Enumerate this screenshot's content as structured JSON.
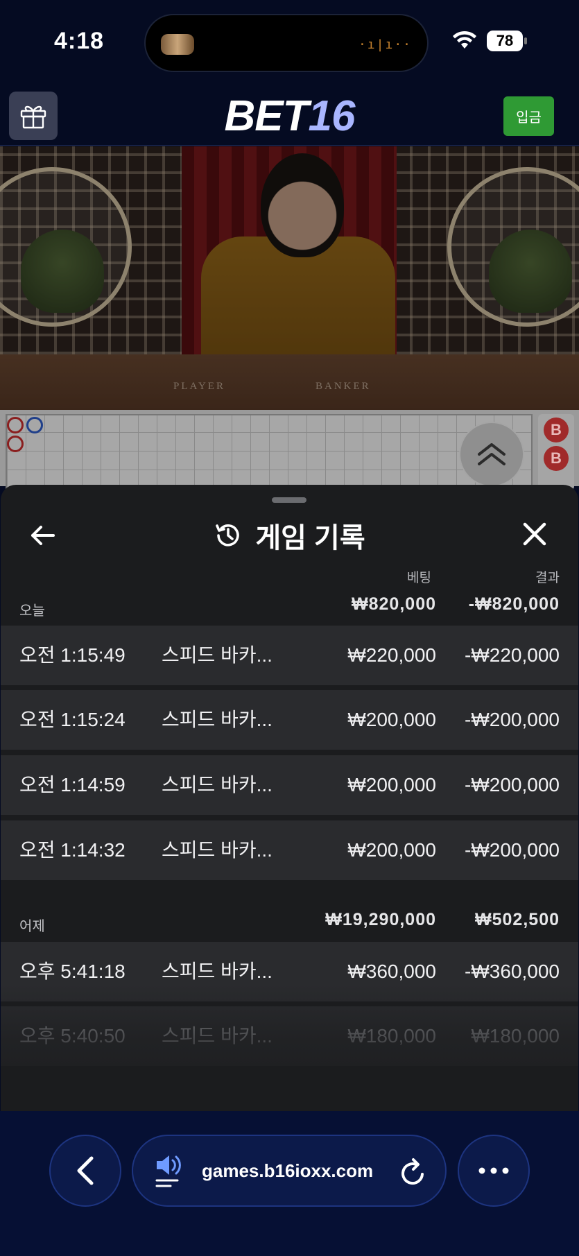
{
  "status_bar": {
    "time": "4:18",
    "battery": "78",
    "wave": "·ı|ı··"
  },
  "header": {
    "logo_bet": "BET",
    "logo_num": "16",
    "deposit_label": "입금"
  },
  "video": {
    "player_label": "PLAYER",
    "banker_label": "BANKER"
  },
  "roadmap": {
    "side_chips": [
      "B",
      "B"
    ]
  },
  "sheet": {
    "title": "게임 기록",
    "columns": {
      "bet": "베팅",
      "result": "결과"
    },
    "groups": [
      {
        "label": "오늘",
        "total_bet": "₩820,000",
        "total_result": "-₩820,000",
        "rows": [
          {
            "time": "오전 1:15:49",
            "game": "스피드 바카...",
            "bet": "₩220,000",
            "result": "-₩220,000"
          },
          {
            "time": "오전 1:15:24",
            "game": "스피드 바카...",
            "bet": "₩200,000",
            "result": "-₩200,000"
          },
          {
            "time": "오전 1:14:59",
            "game": "스피드 바카...",
            "bet": "₩200,000",
            "result": "-₩200,000"
          },
          {
            "time": "오전 1:14:32",
            "game": "스피드 바카...",
            "bet": "₩200,000",
            "result": "-₩200,000"
          }
        ]
      },
      {
        "label": "어제",
        "total_bet": "₩19,290,000",
        "total_result": "₩502,500",
        "rows": [
          {
            "time": "오후 5:41:18",
            "game": "스피드 바카...",
            "bet": "₩360,000",
            "result": "-₩360,000"
          },
          {
            "time": "오후 5:40:50",
            "game": "스피드 바카...",
            "bet": "₩180,000",
            "result": "₩180,000"
          }
        ]
      }
    ]
  },
  "browser": {
    "url": "games.b16ioxx.com"
  },
  "colors": {
    "background": "#050b22",
    "deposit_green": "#2f9a34",
    "sheet_bg": "#1b1c1e",
    "row_bg": "#2a2b2e",
    "logo_accent": "#a9b6ff"
  },
  "icons": [
    "gift-icon",
    "wifi-icon",
    "history-icon",
    "back-arrow-icon",
    "close-icon",
    "chevron-double-up-icon",
    "chevron-left-icon",
    "speaker-icon",
    "reload-icon",
    "more-icon"
  ]
}
